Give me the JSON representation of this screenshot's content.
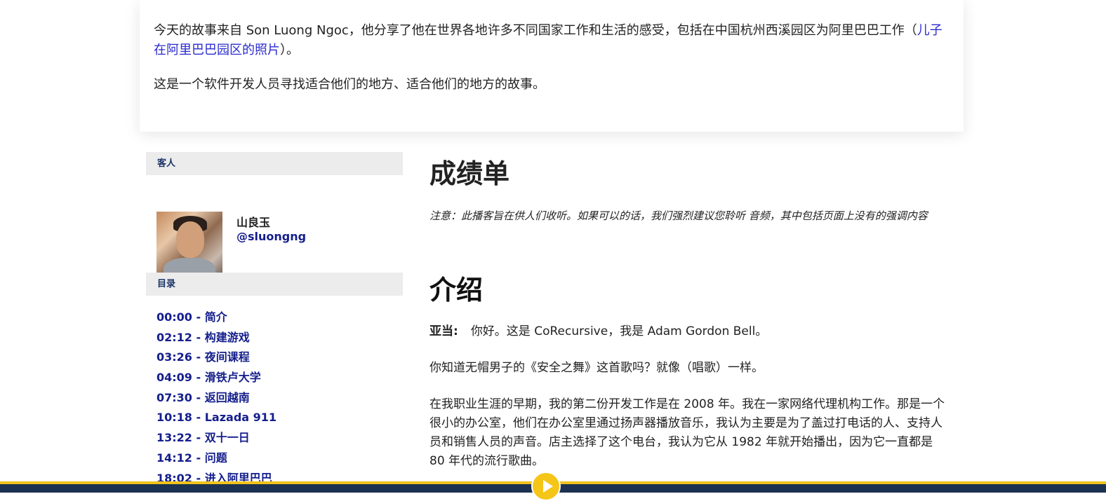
{
  "intro": {
    "p1_before": "今天的故事来自 Son Luong Ngoc，他分享了他在世界各地许多不同国家工作和生活的感受，包括在中国杭州西溪园区为阿里巴巴工作（",
    "p1_link": "儿子在阿里巴巴园区的照片",
    "p1_after": "）。",
    "p2": "这是一个软件开发人员寻找适合他们的地方、适合他们的地方的故事。"
  },
  "sidebar": {
    "guest_heading": "客人",
    "guest_name": "山良玉",
    "guest_handle": "@sluongng",
    "toc_heading": "目录",
    "toc": [
      {
        "time": "00:00",
        "title": "简介"
      },
      {
        "time": "02:12",
        "title": "构建游戏"
      },
      {
        "time": "03:26",
        "title": "夜间课程"
      },
      {
        "time": "04:09",
        "title": "滑铁卢大学"
      },
      {
        "time": "07:30",
        "title": "返回越南"
      },
      {
        "time": "10:18",
        "title": "Lazada 911"
      },
      {
        "time": "13:22",
        "title": "双十一日"
      },
      {
        "time": "14:12",
        "title": "问题"
      },
      {
        "time": "18:02",
        "title": "进入阿里巴巴"
      }
    ]
  },
  "main": {
    "title": "成绩单",
    "note": "注意：此播客旨在供人们收听。如果可以的话，我们强烈建议您聆听 音频，其中包括页面上没有的强调内容",
    "section_title": "介绍",
    "speaker": "亚当:",
    "line1": "你好。这是 CoRecursive，我是 Adam Gordon Bell。",
    "line2": "你知道无帽男子的《安全之舞》这首歌吗？就像（唱歌）一样。",
    "line3": "在我职业生涯的早期，我的第二份开发工作是在 2008 年。我在一家网络代理机构工作。那是一个很小的办公室，他们在办公室里通过扬声器播放音乐，我认为主要是为了盖过打电话的人、支持人员和销售人员的声音。店主选择了这个电台，我认为它从 1982 年就开始播出，因为它一直都是 80 年代的流行歌曲。"
  },
  "player": {
    "play_icon": "play-icon",
    "accent": "#f5c518",
    "bar_color": "#1c3250"
  }
}
